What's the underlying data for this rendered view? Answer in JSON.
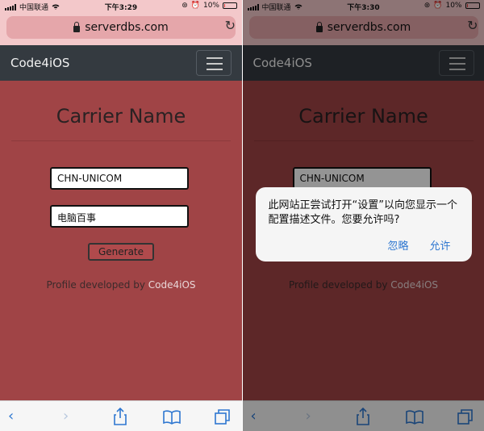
{
  "left": {
    "status": {
      "carrier": "中国联通",
      "time": "下午3:29",
      "battery": "10%",
      "battery_level": 0.1
    },
    "url": "serverdbs.com",
    "navbar": {
      "brand": "Code4iOS"
    },
    "page": {
      "title": "Carrier Name",
      "carrier_field_value": "CHN-UNICOM",
      "name_field_value": "电脑百事",
      "generate_label": "Generate",
      "credit_prefix": "Profile developed by ",
      "credit_link": "Code4iOS"
    }
  },
  "right": {
    "status": {
      "carrier": "中国联通",
      "time": "下午3:30",
      "battery": "10%",
      "battery_level": 0.1
    },
    "url": "serverdbs.com",
    "navbar": {
      "brand": "Code4iOS"
    },
    "page": {
      "title": "Carrier Name",
      "carrier_field_value": "CHN-UNICOM",
      "credit_prefix": "Profile developed by ",
      "credit_link": "Code4iOS"
    },
    "alert": {
      "message": "此网站正尝试打开“设置”以向您显示一个配置描述文件。您要允许吗?",
      "ignore_label": "忽略",
      "allow_label": "允许"
    }
  },
  "toolbar_icons": {
    "back": "chevron-left-icon",
    "forward": "chevron-right-icon",
    "share": "share-icon",
    "bookmarks": "book-icon",
    "tabs": "tabs-icon"
  },
  "colors": {
    "page_bg": "#a04446",
    "navbar_bg": "#343a40",
    "link_blue": "#2e77d0"
  }
}
